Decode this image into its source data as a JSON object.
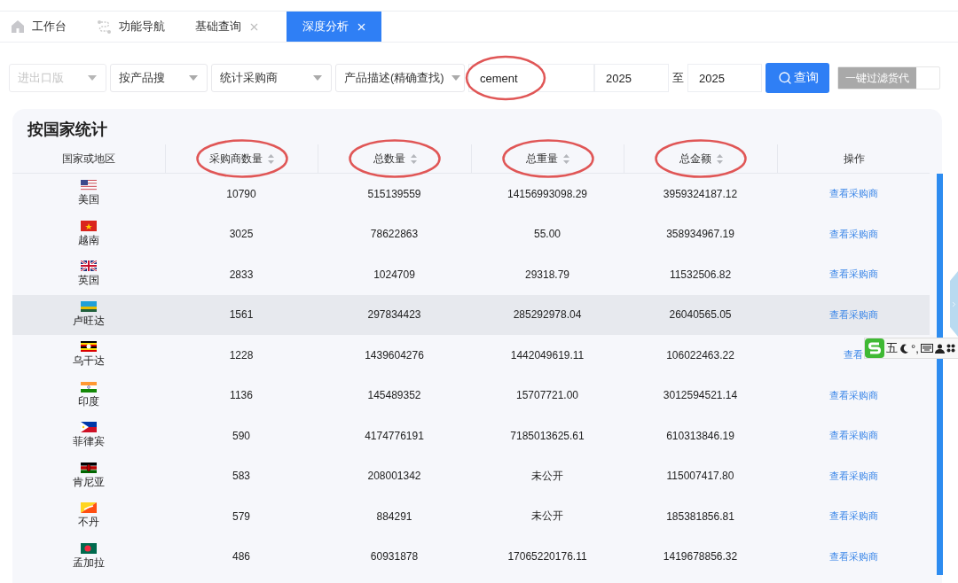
{
  "tabs": [
    {
      "label": "工作台",
      "closable": false,
      "selected": false
    },
    {
      "label": "功能导航",
      "closable": false,
      "selected": false
    },
    {
      "label": "基础查询",
      "closable": true,
      "selected": false
    },
    {
      "label": "深度分析",
      "closable": true,
      "selected": true
    }
  ],
  "filters": [
    {
      "kind": "select",
      "placeholder": "进出口版",
      "disabled": true
    },
    {
      "kind": "select",
      "value": "按产品搜",
      "disabled": false
    },
    {
      "kind": "select",
      "value": "统计采购商",
      "disabled": false
    },
    {
      "kind": "select",
      "value": "产品描述(精确查找)",
      "disabled": false
    },
    {
      "kind": "input",
      "value": "cement",
      "circled": true
    },
    {
      "kind": "input",
      "value": "2025",
      "circled": false
    },
    {
      "kind": "separator",
      "value": "至"
    },
    {
      "kind": "input",
      "value": "2025",
      "circled": false
    }
  ],
  "search_button": "查询",
  "filter_forwarders": {
    "label": "一键过滤货代",
    "on": false
  },
  "card": {
    "title": "按国家统计",
    "columns": [
      {
        "label": "国家或地区",
        "sortable": false,
        "circled": false
      },
      {
        "label": "采购商数量",
        "sortable": true,
        "circled": true
      },
      {
        "label": "总数量",
        "sortable": true,
        "circled": true
      },
      {
        "label": "总重量",
        "sortable": true,
        "circled": true
      },
      {
        "label": "总金额",
        "sortable": true,
        "circled": true
      },
      {
        "label": "操作",
        "sortable": false,
        "circled": false
      }
    ],
    "rows": [
      {
        "country": "美国",
        "buyers": "10790",
        "quantity": "515139559",
        "weight": "14156993098.29",
        "amount": "3959324187.12",
        "action": "查看采购商",
        "highlighted": false
      },
      {
        "country": "越南",
        "buyers": "3025",
        "quantity": "78622863",
        "weight": "55.00",
        "amount": "358934967.19",
        "action": "查看采购商",
        "highlighted": false
      },
      {
        "country": "英国",
        "buyers": "2833",
        "quantity": "1024709",
        "weight": "29318.79",
        "amount": "11532506.82",
        "action": "查看采购商",
        "highlighted": false
      },
      {
        "country": "卢旺达",
        "buyers": "1561",
        "quantity": "297834423",
        "weight": "285292978.04",
        "amount": "26040565.05",
        "action": "查看采购商",
        "highlighted": true
      },
      {
        "country": "乌干达",
        "buyers": "1228",
        "quantity": "1439604276",
        "weight": "1442049619.11",
        "amount": "106022463.22",
        "action": "查看",
        "highlighted": false
      },
      {
        "country": "印度",
        "buyers": "1136",
        "quantity": "145489352",
        "weight": "15707721.00",
        "amount": "3012594521.14",
        "action": "查看采购商",
        "highlighted": false
      },
      {
        "country": "菲律宾",
        "buyers": "590",
        "quantity": "4174776191",
        "weight": "7185013625.61",
        "amount": "610313846.19",
        "action": "查看采购商",
        "highlighted": false
      },
      {
        "country": "肯尼亚",
        "buyers": "583",
        "quantity": "208001342",
        "weight": "未公开",
        "amount": "115007417.80",
        "action": "查看采购商",
        "highlighted": false
      },
      {
        "country": "不丹",
        "buyers": "579",
        "quantity": "884291",
        "weight": "未公开",
        "amount": "185381856.81",
        "action": "查看采购商",
        "highlighted": false
      },
      {
        "country": "孟加拉",
        "buyers": "486",
        "quantity": "60931878",
        "weight": "17065220176.11",
        "amount": "1419678856.32",
        "action": "查看采购商",
        "highlighted": false
      }
    ]
  },
  "ime_toolbar": {
    "mode": "五",
    "punct": "°,"
  }
}
